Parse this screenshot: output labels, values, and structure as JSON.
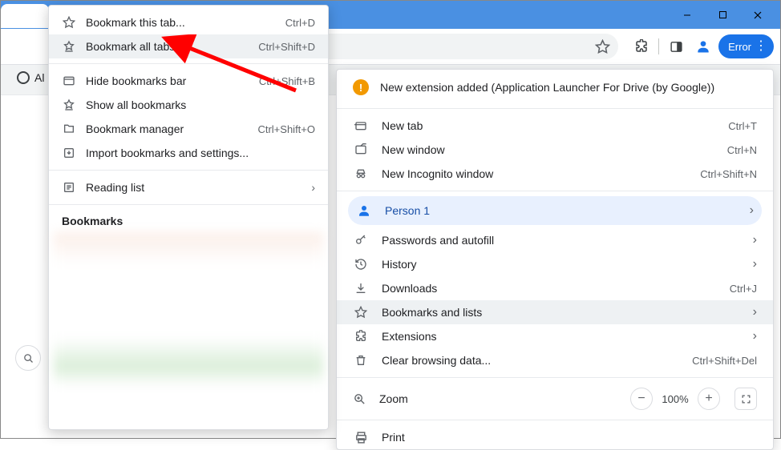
{
  "window": {
    "minimize": "—",
    "maximize": "☐",
    "close": "✕"
  },
  "toolbar": {
    "error_label": "Error"
  },
  "content_band": {
    "left_label": "Al"
  },
  "main_menu": {
    "ext_notice": "New extension added (Application Launcher For Drive (by Google))",
    "items": [
      {
        "icon": "tab",
        "label": "New tab",
        "accel": "Ctrl+T"
      },
      {
        "icon": "window",
        "label": "New window",
        "accel": "Ctrl+N"
      },
      {
        "icon": "incognito",
        "label": "New Incognito window",
        "accel": "Ctrl+Shift+N"
      }
    ],
    "profile": {
      "label": "Person 1"
    },
    "section2": [
      {
        "icon": "key",
        "label": "Passwords and autofill",
        "sub": true
      },
      {
        "icon": "history",
        "label": "History",
        "sub": true
      },
      {
        "icon": "download",
        "label": "Downloads",
        "accel": "Ctrl+J"
      },
      {
        "icon": "star",
        "label": "Bookmarks and lists",
        "sub": true,
        "hover": true
      },
      {
        "icon": "ext",
        "label": "Extensions",
        "sub": true
      },
      {
        "icon": "trash",
        "label": "Clear browsing data...",
        "accel": "Ctrl+Shift+Del"
      }
    ],
    "zoom": {
      "label": "Zoom",
      "value": "100%"
    },
    "print": {
      "label": "Print"
    }
  },
  "sub_menu": {
    "items": [
      {
        "icon": "star",
        "label": "Bookmark this tab...",
        "accel": "Ctrl+D"
      },
      {
        "icon": "star-multi",
        "label": "Bookmark all tabs...",
        "accel": "Ctrl+Shift+D",
        "hover": true
      }
    ],
    "section2": [
      {
        "icon": "bar",
        "label": "Hide bookmarks bar",
        "accel": "Ctrl+Shift+B"
      },
      {
        "icon": "star-multi",
        "label": "Show all bookmarks"
      },
      {
        "icon": "manager",
        "label": "Bookmark manager",
        "accel": "Ctrl+Shift+O"
      },
      {
        "icon": "import",
        "label": "Import bookmarks and settings..."
      }
    ],
    "reading": {
      "label": "Reading list"
    },
    "bm_title": "Bookmarks"
  }
}
